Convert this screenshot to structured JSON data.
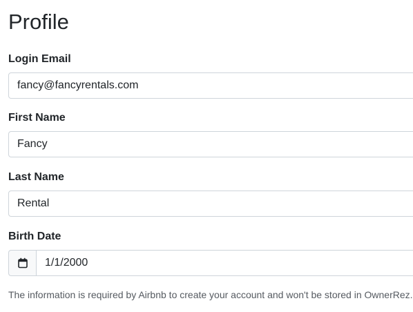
{
  "page": {
    "title": "Profile"
  },
  "form": {
    "login_email": {
      "label": "Login Email",
      "value": "fancy@fancyrentals.com"
    },
    "first_name": {
      "label": "First Name",
      "value": "Fancy"
    },
    "last_name": {
      "label": "Last Name",
      "value": "Rental"
    },
    "birth_date": {
      "label": "Birth Date",
      "value": "1/1/2000",
      "icon": "calendar-icon"
    }
  },
  "help_text": "The information is required by Airbnb to create your account and won't be stored in OwnerRez.",
  "colors": {
    "text": "#212529",
    "border": "#ced4da",
    "muted_text": "#555a60"
  }
}
